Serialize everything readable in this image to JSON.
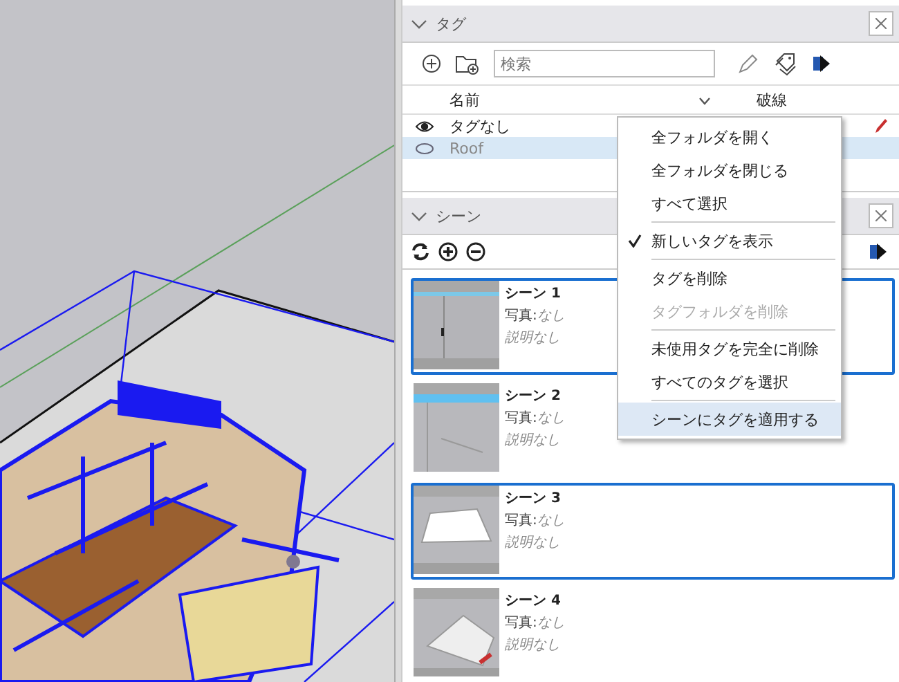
{
  "tags_panel": {
    "title": "タグ",
    "expanded": true,
    "search": {
      "placeholder": "検索"
    },
    "columns": [
      {
        "label": "名前"
      },
      {
        "label": "破線"
      }
    ],
    "rows": [
      {
        "name": "タグなし",
        "visible": true,
        "current": true,
        "selected": false
      },
      {
        "name": "Roof",
        "visible": false,
        "current": false,
        "selected": true
      }
    ]
  },
  "scenes_panel": {
    "title": "シーン",
    "expanded": true,
    "scenes": [
      {
        "name": "シーン 1",
        "photo_label": "写真:",
        "photo": "なし",
        "description": "説明なし",
        "selected": true,
        "kind": "wall"
      },
      {
        "name": "シーン 2",
        "photo_label": "写真:",
        "photo": "なし",
        "description": "説明なし",
        "selected": false,
        "kind": "sky"
      },
      {
        "name": "シーン 3",
        "photo_label": "写真:",
        "photo": "なし",
        "description": "説明なし",
        "selected": true,
        "kind": "plane"
      },
      {
        "name": "シーン 4",
        "photo_label": "写真:",
        "photo": "なし",
        "description": "説明なし",
        "selected": false,
        "kind": "tilted"
      }
    ]
  },
  "context_menu": {
    "items": [
      {
        "kind": "item",
        "label": "全フォルダを開く",
        "checked": false,
        "disabled": false,
        "selected": false
      },
      {
        "kind": "item",
        "label": "全フォルダを閉じる",
        "checked": false,
        "disabled": false,
        "selected": false
      },
      {
        "kind": "item",
        "label": "すべて選択",
        "checked": false,
        "disabled": false,
        "selected": false
      },
      {
        "kind": "separator"
      },
      {
        "kind": "item",
        "label": "新しいタグを表示",
        "checked": true,
        "disabled": false,
        "selected": false
      },
      {
        "kind": "separator"
      },
      {
        "kind": "item",
        "label": "タグを削除",
        "checked": false,
        "disabled": false,
        "selected": false
      },
      {
        "kind": "item",
        "label": "タグフォルダを削除",
        "checked": false,
        "disabled": true,
        "selected": false
      },
      {
        "kind": "separator"
      },
      {
        "kind": "item",
        "label": "未使用タグを完全に削除",
        "checked": false,
        "disabled": false,
        "selected": false
      },
      {
        "kind": "item",
        "label": "すべてのタグを選択",
        "checked": false,
        "disabled": false,
        "selected": false
      },
      {
        "kind": "separator"
      },
      {
        "kind": "item",
        "label": "シーンにタグを適用する",
        "checked": false,
        "disabled": false,
        "selected": true
      }
    ]
  }
}
